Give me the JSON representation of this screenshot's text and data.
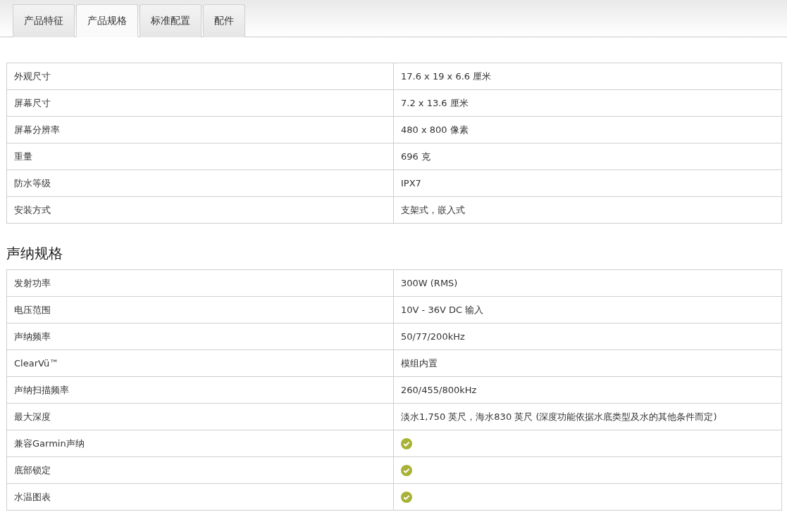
{
  "tabs": [
    {
      "label": "产品特征",
      "selected": false
    },
    {
      "label": "产品规格",
      "selected": true
    },
    {
      "label": "标准配置",
      "selected": false
    },
    {
      "label": "配件",
      "selected": false
    }
  ],
  "sections": [
    {
      "rows": [
        {
          "label": "外观尺寸",
          "kind": "text",
          "value": "17.6 x 19 x 6.6 厘米"
        },
        {
          "label": "屏幕尺寸",
          "kind": "text",
          "value": "7.2 x 13.6 厘米"
        },
        {
          "label": "屏幕分辨率",
          "kind": "text",
          "value": "480 x 800 像素"
        },
        {
          "label": "重量",
          "kind": "text",
          "value": "696 克"
        },
        {
          "label": "防水等级",
          "kind": "text",
          "value": "IPX7"
        },
        {
          "label": "安装方式",
          "kind": "text",
          "value": "支架式，嵌入式"
        }
      ]
    },
    {
      "heading": "声纳规格",
      "rows": [
        {
          "label": "发射功率",
          "kind": "text",
          "value": "300W (RMS)"
        },
        {
          "label": "电压范围",
          "kind": "text",
          "value": "10V - 36V DC 输入"
        },
        {
          "label": "声纳频率",
          "kind": "text",
          "value": "50/77/200kHz"
        },
        {
          "label": "ClearVü™",
          "kind": "text",
          "value": "模组内置"
        },
        {
          "label": "声纳扫描频率",
          "kind": "text",
          "value": "260/455/800kHz"
        },
        {
          "label": "最大深度",
          "kind": "text",
          "value": "淡水1,750 英尺，海水830 英尺 (深度功能依据水底类型及水的其他条件而定)"
        },
        {
          "label": "兼容Garmin声纳",
          "kind": "check",
          "checked": true
        },
        {
          "label": "底部锁定",
          "kind": "check",
          "checked": true
        },
        {
          "label": "水温图表",
          "kind": "check",
          "checked": true
        }
      ]
    }
  ]
}
